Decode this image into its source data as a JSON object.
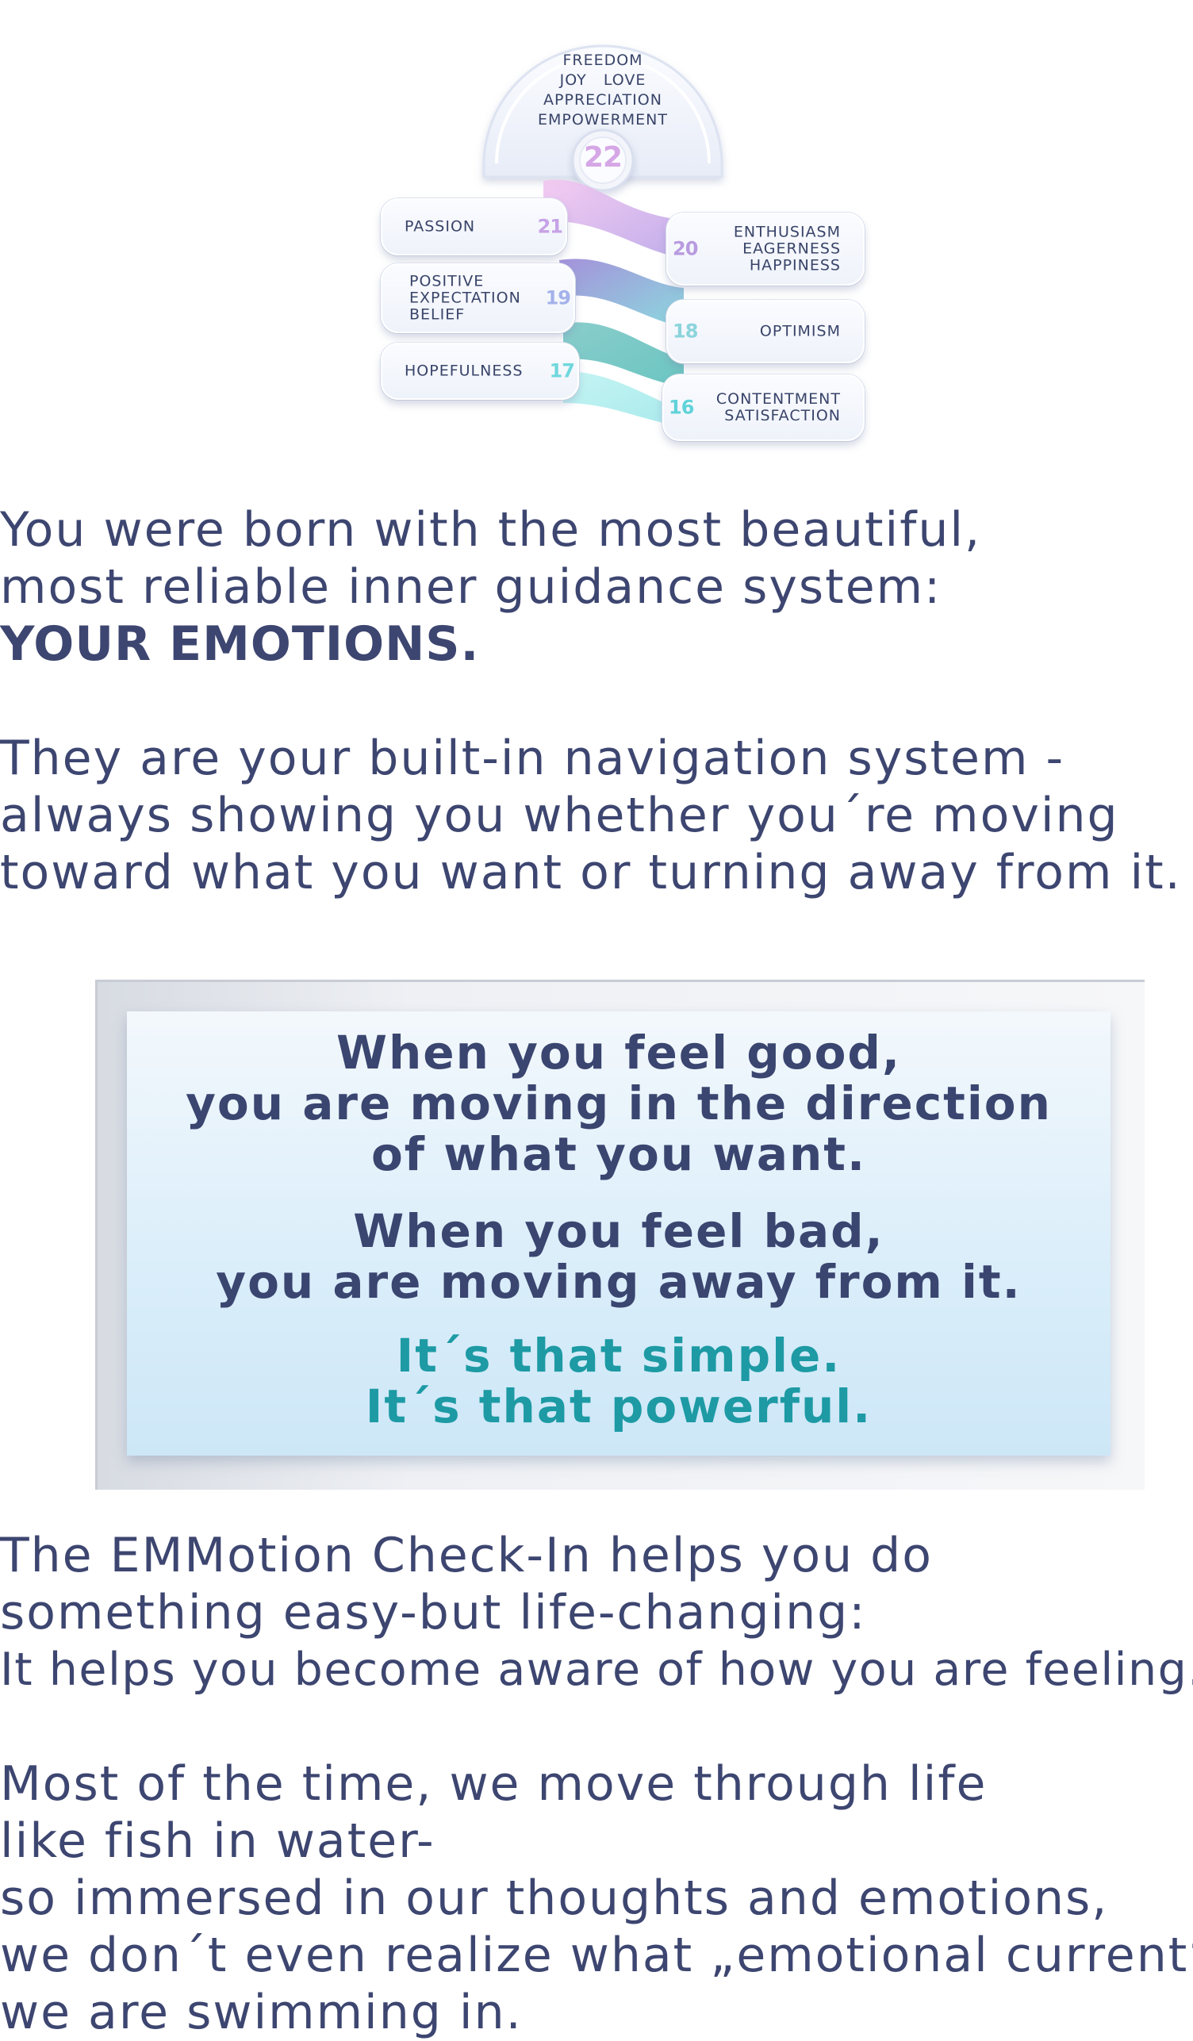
{
  "scale": {
    "top": {
      "lines": [
        "FREEDOM",
        "JOY   LOVE",
        "APPRECIATION",
        "EMPOWERMENT"
      ],
      "number": "22"
    },
    "items": [
      {
        "side": "left",
        "lines": [
          "PASSION"
        ],
        "number": "21",
        "color": "#c6a2e6"
      },
      {
        "side": "right",
        "lines": [
          "ENTHUSIASM",
          "EAGERNESS",
          "HAPPINESS"
        ],
        "number": "20",
        "color": "#b89be0"
      },
      {
        "side": "left",
        "lines": [
          "POSITIVE",
          "EXPECTATION",
          "BELIEF"
        ],
        "number": "19",
        "color": "#a4b2ea"
      },
      {
        "side": "right",
        "lines": [
          "OPTIMISM"
        ],
        "number": "18",
        "color": "#8cd4dc"
      },
      {
        "side": "left",
        "lines": [
          "HOPEFULNESS"
        ],
        "number": "17",
        "color": "#6fd8dc"
      },
      {
        "side": "right",
        "lines": [
          "CONTENTMENT",
          "SATISFACTION"
        ],
        "number": "16",
        "color": "#5fd3d9"
      }
    ]
  },
  "intro": {
    "line1": "You were born with the most beautiful,",
    "line2": "most reliable inner guidance system:",
    "line3": "YOUR EMOTIONS."
  },
  "nav": {
    "line1": "They are your built-in navigation system -",
    "line2": "always showing you whether you´re moving",
    "line3": "toward what you want or turning away from it."
  },
  "quote": {
    "good1": "When you feel good,",
    "good2": "you are moving in the direction",
    "good3": "of what you want.",
    "bad1": "When you feel bad,",
    "bad2": "you are moving away from it.",
    "simple1": "It´s that simple.",
    "simple2": "It´s that powerful.",
    "accent_color": "#1d9aa4"
  },
  "checkin": {
    "line1": "The EMMotion Check-In helps you do",
    "line2": "something easy-but life-changing:",
    "line3": "It helps you become aware of how you are feeling."
  },
  "fish": {
    "line1": "Most of the time, we move through life",
    "line2": "like fish in water-",
    "line3": "so immersed in our thoughts and emotions,",
    "line4": "we don´t even realize what „emotional current“",
    "line5": "we are swimming in."
  }
}
